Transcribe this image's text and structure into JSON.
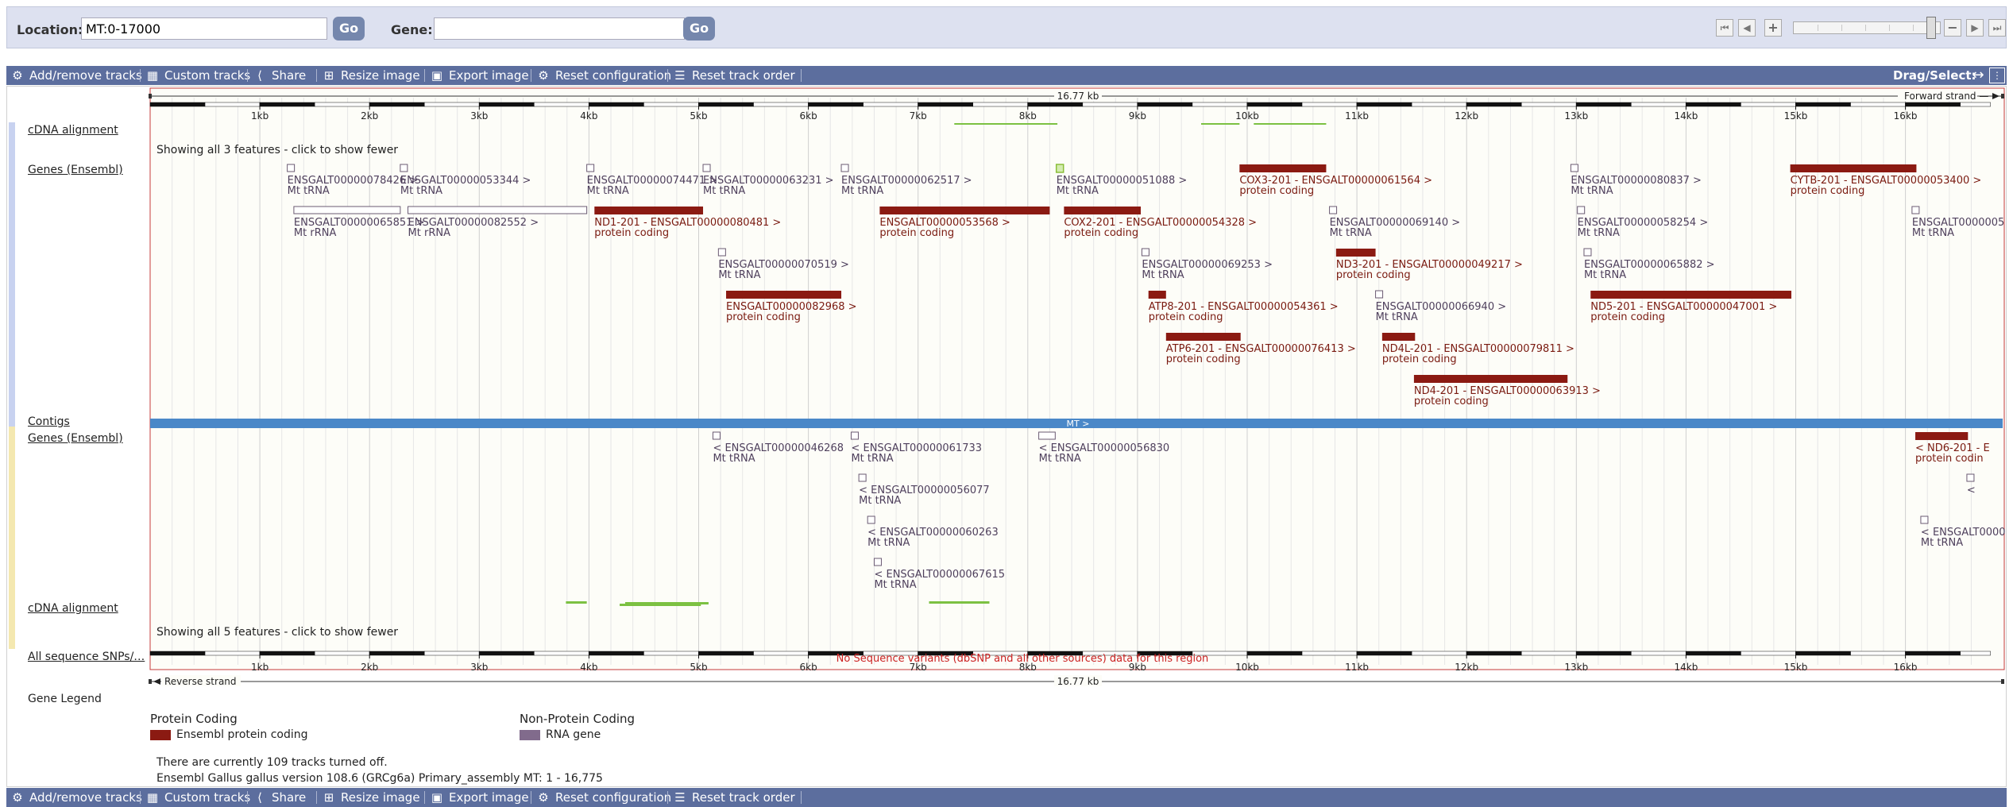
{
  "location": {
    "label": "Location:",
    "value": "MT:0-17000",
    "go_label": "Go"
  },
  "gene": {
    "label": "Gene:",
    "value": "",
    "go_label": "Go"
  },
  "navigation": {
    "icons": [
      "first-icon",
      "previous-icon",
      "zoom-in-icon",
      "zoom-out-icon",
      "next-icon",
      "last-icon"
    ]
  },
  "toolbar": {
    "items": [
      {
        "label": "Add/remove tracks",
        "icon": "gear-icon"
      },
      {
        "label": "Custom tracks",
        "icon": "custom-tracks-icon"
      },
      {
        "label": "Share",
        "icon": "share-icon"
      },
      {
        "label": "Resize image",
        "icon": "resize-icon"
      },
      {
        "label": "Export image",
        "icon": "export-icon"
      },
      {
        "label": "Reset configuration",
        "icon": "reset-config-icon"
      },
      {
        "label": "Reset track order",
        "icon": "reset-order-icon"
      }
    ],
    "drag_select_label": "Drag/Select:"
  },
  "ruler": {
    "scale_label": "16.77 kb",
    "forward_label": "Forward strand",
    "reverse_label": "Reverse strand",
    "ticks": [
      "1kb",
      "2kb",
      "3kb",
      "4kb",
      "5kb",
      "6kb",
      "7kb",
      "8kb",
      "9kb",
      "10kb",
      "11kb",
      "12kb",
      "13kb",
      "14kb",
      "15kb",
      "16kb"
    ]
  },
  "track_labels": {
    "cdna_top": "cDNA alignment",
    "genes_forward": "Genes (Ensembl)",
    "contigs": "Contigs",
    "genes_reverse": "Genes (Ensembl)",
    "cdna_bottom": "cDNA alignment",
    "snps": "All sequence SNPs/…",
    "legend": "Gene Legend"
  },
  "messages": {
    "cdna_top": "Showing all 3 features - click to show fewer",
    "cdna_bottom": "Showing all 5 features - click to show fewer",
    "snps": "No Sequence variants (dbSNP and all other sources) data for this region"
  },
  "contig": {
    "label": "MT >"
  },
  "forward_genes": [
    {
      "start": 1250,
      "end": 1310,
      "row": 0,
      "type": "rna",
      "label": "ENSGALT00000078426 >",
      "bio": "Mt tRNA"
    },
    {
      "start": 2280,
      "end": 2340,
      "row": 0,
      "type": "rna",
      "label": "ENSGALT00000053344 >",
      "bio": "Mt tRNA"
    },
    {
      "start": 3980,
      "end": 4040,
      "row": 0,
      "type": "rna",
      "label": "ENSGALT00000074471 >",
      "bio": "Mt tRNA"
    },
    {
      "start": 5040,
      "end": 5100,
      "row": 0,
      "type": "rna",
      "label": "ENSGALT00000063231 >",
      "bio": "Mt tRNA"
    },
    {
      "start": 6300,
      "end": 6360,
      "row": 0,
      "type": "rna",
      "label": "ENSGALT00000062517 >",
      "bio": "Mt tRNA"
    },
    {
      "start": 8260,
      "end": 8320,
      "row": 0,
      "type": "rna_sel",
      "label": "ENSGALT00000051088 >",
      "bio": "Mt tRNA"
    },
    {
      "start": 9930,
      "end": 10720,
      "row": 0,
      "type": "protein",
      "label": "COX3-201 - ENSGALT00000061564 >",
      "bio": "protein coding"
    },
    {
      "start": 12950,
      "end": 13010,
      "row": 0,
      "type": "rna",
      "label": "ENSGALT00000080837 >",
      "bio": "Mt tRNA"
    },
    {
      "start": 14950,
      "end": 16100,
      "row": 0,
      "type": "protein",
      "label": "CYTB-201 - ENSGALT00000053400 >",
      "bio": "protein coding"
    },
    {
      "start": 1310,
      "end": 2280,
      "row": 1,
      "type": "rna",
      "label": "ENSGALT00000065851 >",
      "bio": "Mt rRNA"
    },
    {
      "start": 2350,
      "end": 3980,
      "row": 1,
      "type": "rna",
      "label": "ENSGALT00000082552 >",
      "bio": "Mt rRNA"
    },
    {
      "start": 4050,
      "end": 5040,
      "row": 1,
      "type": "protein",
      "label": "ND1-201 - ENSGALT00000080481 >",
      "bio": "protein coding"
    },
    {
      "start": 6650,
      "end": 8200,
      "row": 1,
      "type": "protein",
      "label": "ENSGALT00000053568 >",
      "bio": "protein coding"
    },
    {
      "start": 8330,
      "end": 9030,
      "row": 1,
      "type": "protein",
      "label": "COX2-201 - ENSGALT00000054328 >",
      "bio": "protein coding"
    },
    {
      "start": 10750,
      "end": 10810,
      "row": 1,
      "type": "rna",
      "label": "ENSGALT00000069140 >",
      "bio": "Mt tRNA"
    },
    {
      "start": 13010,
      "end": 13070,
      "row": 1,
      "type": "rna",
      "label": "ENSGALT00000058254 >",
      "bio": "Mt tRNA"
    },
    {
      "start": 16060,
      "end": 16120,
      "row": 1,
      "type": "rna",
      "label": "ENSGALT0000005",
      "bio": "Mt tRNA"
    },
    {
      "start": 5180,
      "end": 5240,
      "row": 2,
      "type": "rna",
      "label": "ENSGALT00000070519 >",
      "bio": "Mt tRNA"
    },
    {
      "start": 9040,
      "end": 9100,
      "row": 2,
      "type": "rna",
      "label": "ENSGALT00000069253 >",
      "bio": "Mt tRNA"
    },
    {
      "start": 10810,
      "end": 11170,
      "row": 2,
      "type": "protein",
      "label": "ND3-201 - ENSGALT00000049217 >",
      "bio": "protein coding"
    },
    {
      "start": 13070,
      "end": 13130,
      "row": 2,
      "type": "rna",
      "label": "ENSGALT00000065882 >",
      "bio": "Mt tRNA"
    },
    {
      "start": 5250,
      "end": 6300,
      "row": 3,
      "type": "protein",
      "label": "ENSGALT00000082968 >",
      "bio": "protein coding"
    },
    {
      "start": 9100,
      "end": 9260,
      "row": 3,
      "type": "protein",
      "label": "ATP8-201 - ENSGALT00000054361 >",
      "bio": "protein coding"
    },
    {
      "start": 11170,
      "end": 11230,
      "row": 3,
      "type": "rna",
      "label": "ENSGALT00000066940 >",
      "bio": "Mt tRNA"
    },
    {
      "start": 13130,
      "end": 14960,
      "row": 3,
      "type": "protein",
      "label": "ND5-201 - ENSGALT00000047001 >",
      "bio": "protein coding"
    },
    {
      "start": 9260,
      "end": 9940,
      "row": 4,
      "type": "protein",
      "label": "ATP6-201 - ENSGALT00000076413 >",
      "bio": "protein coding"
    },
    {
      "start": 11230,
      "end": 11530,
      "row": 4,
      "type": "protein",
      "label": "ND4L-201 - ENSGALT00000079811 >",
      "bio": "protein coding"
    },
    {
      "start": 11520,
      "end": 12920,
      "row": 5,
      "type": "protein",
      "label": "ND4-201 - ENSGALT00000063913 >",
      "bio": "protein coding"
    }
  ],
  "reverse_genes": [
    {
      "start": 5130,
      "end": 5190,
      "row": 0,
      "type": "rna",
      "label": "< ENSGALT00000046268",
      "bio": "Mt tRNA"
    },
    {
      "start": 6390,
      "end": 6450,
      "row": 0,
      "type": "rna",
      "label": "< ENSGALT00000061733",
      "bio": "Mt tRNA"
    },
    {
      "start": 8100,
      "end": 8250,
      "row": 0,
      "type": "rna",
      "label": "< ENSGALT00000056830",
      "bio": "Mt tRNA"
    },
    {
      "start": 16090,
      "end": 16570,
      "row": 0,
      "type": "protein",
      "label": "< ND6-201 - E",
      "bio": "protein codin"
    },
    {
      "start": 6460,
      "end": 6520,
      "row": 1,
      "type": "rna",
      "label": "< ENSGALT00000056077",
      "bio": "Mt tRNA"
    },
    {
      "start": 16560,
      "end": 16620,
      "row": 1,
      "type": "rna",
      "label": "<",
      "bio": ""
    },
    {
      "start": 6540,
      "end": 6600,
      "row": 2,
      "type": "rna",
      "label": "< ENSGALT00000060263",
      "bio": "Mt tRNA"
    },
    {
      "start": 16140,
      "end": 16200,
      "row": 2,
      "type": "rna",
      "label": "< ENSGALT0000",
      "bio": "Mt tRNA"
    },
    {
      "start": 6600,
      "end": 6660,
      "row": 3,
      "type": "rna",
      "label": "< ENSGALT00000067615",
      "bio": "Mt tRNA"
    }
  ],
  "cdna_top_segments": [
    {
      "start": 7330,
      "end": 8270
    },
    {
      "start": 9580,
      "end": 9930
    },
    {
      "start": 10060,
      "end": 10720
    }
  ],
  "cdna_bottom_segments": [
    {
      "start": 3790,
      "end": 3980
    },
    {
      "start": 4280,
      "end": 4800
    },
    {
      "start": 4330,
      "end": 5090
    },
    {
      "start": 4410,
      "end": 5020
    },
    {
      "start": 7100,
      "end": 7650
    }
  ],
  "colors": {
    "protein_coding": "#8b1a12",
    "rna_gene": "#816b8c",
    "rna_outline": "#6a5a72",
    "cdna": "#7cc142",
    "contig": "#4a88c8",
    "selected_outline": "#8bbf3a",
    "selected_fill": "#d4ecb0",
    "label_protein": "#7a1a10",
    "label_rna": "#4e3f5c",
    "grid": "#dcdcdc",
    "strip_forward": "#c8d2f0",
    "strip_reverse": "#f4e8b0",
    "frame": "#c63a3a"
  },
  "legend": {
    "protein_header": "Protein Coding",
    "protein_item": "Ensembl protein coding",
    "rna_header": "Non-Protein Coding",
    "rna_item": "RNA gene"
  },
  "footer": {
    "tracks_off": "There are currently 109 tracks turned off.",
    "assembly": "Ensembl Gallus gallus version 108.6 (GRCg6a) Primary_assembly MT: 1 - 16,775"
  }
}
